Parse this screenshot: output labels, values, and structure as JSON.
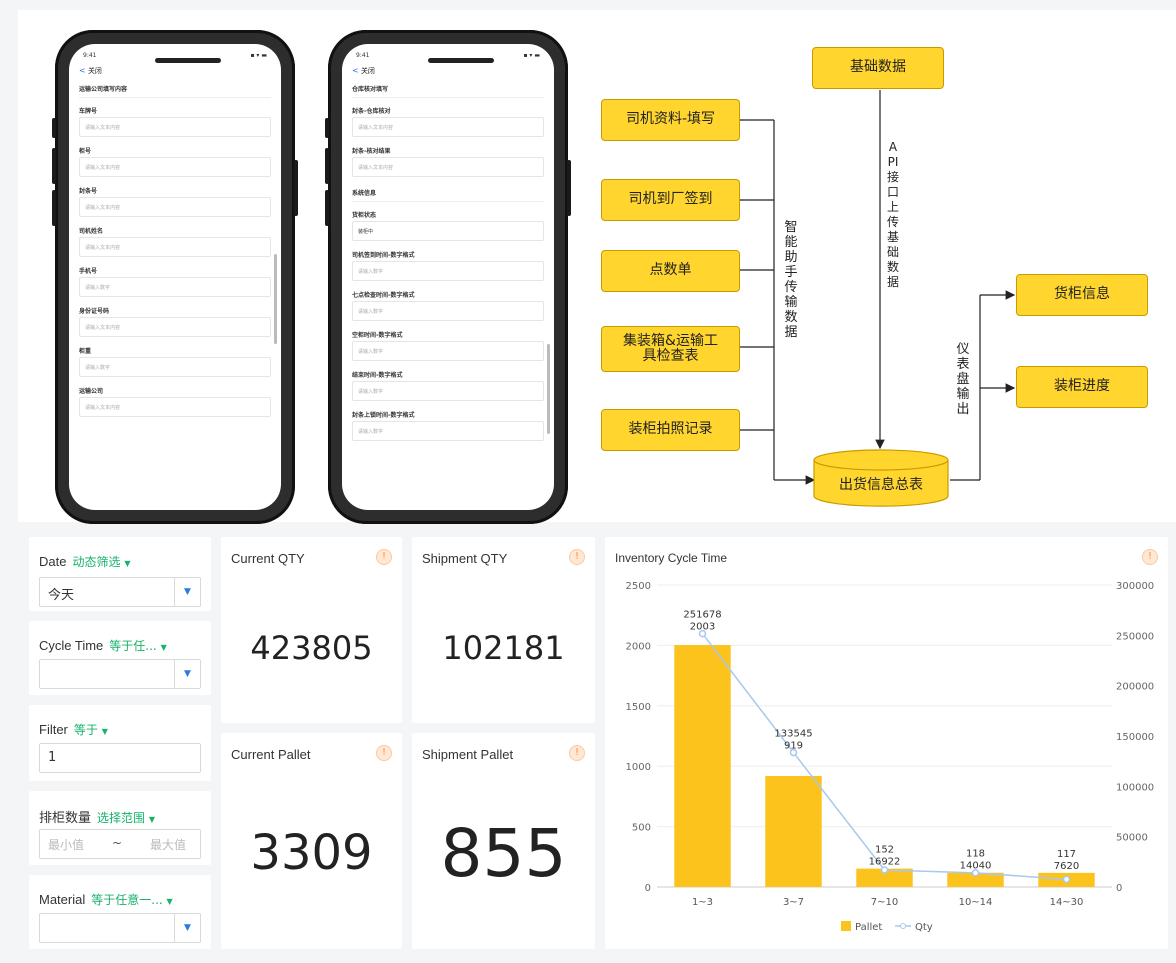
{
  "phone1": {
    "time": "9:41",
    "status_icons": "▪ ▾ ▬",
    "back_label": "关闭",
    "fields": [
      {
        "type": "section",
        "label": "运输公司填写内容"
      },
      {
        "type": "field",
        "label": "车牌号",
        "placeholder": "请输入文本内容"
      },
      {
        "type": "field",
        "label": "柜号",
        "placeholder": "请输入文本内容"
      },
      {
        "type": "field",
        "label": "封条号",
        "placeholder": "请输入文本内容"
      },
      {
        "type": "field",
        "label": "司机姓名",
        "placeholder": "请输入文本内容"
      },
      {
        "type": "field",
        "label": "手机号",
        "placeholder": "请输入数字"
      },
      {
        "type": "field",
        "label": "身份证号码",
        "placeholder": "请输入文本内容"
      },
      {
        "type": "field",
        "label": "柜重",
        "placeholder": "请输入数字"
      },
      {
        "type": "field",
        "label": "运输公司",
        "placeholder": "请输入文本内容"
      }
    ]
  },
  "phone2": {
    "time": "9:41",
    "status_icons": "▪ ▾ ▬",
    "back_label": "关闭",
    "fields": [
      {
        "type": "section",
        "label": "仓库核对填写"
      },
      {
        "type": "field",
        "label": "封条-仓库核对",
        "placeholder": "请输入文本内容"
      },
      {
        "type": "field",
        "label": "封条-核对结果",
        "placeholder": "请输入文本内容"
      },
      {
        "type": "section",
        "label": "系统信息"
      },
      {
        "type": "field",
        "label": "货柜状态",
        "value": "装柜中"
      },
      {
        "type": "field",
        "label": "司机签到时间-数字格式",
        "placeholder": "请输入数字"
      },
      {
        "type": "field",
        "label": "七点检查时间-数字格式",
        "placeholder": "请输入数字"
      },
      {
        "type": "field",
        "label": "空柜时间-数字格式",
        "placeholder": "请输入数字"
      },
      {
        "type": "field",
        "label": "结束时间-数字格式",
        "placeholder": "请输入数字"
      },
      {
        "type": "field",
        "label": "封条上锁时间-数字格式",
        "placeholder": "请输入数字"
      }
    ]
  },
  "flow": {
    "base_data": "基础数据",
    "inputs": [
      "司机资料-填写",
      "司机到厂签到",
      "点数单",
      "集装箱&运输工具检查表",
      "装柜拍照记录"
    ],
    "assistant_label": "智能助手传输数据",
    "api_label": "API接口上传基础数据",
    "dashboard_label": "仪表盘输出",
    "summary_table": "出货信息总表",
    "outputs": [
      "货柜信息",
      "装柜进度"
    ]
  },
  "filters": {
    "date": {
      "label": "Date",
      "op": "动态筛选",
      "value": "今天"
    },
    "cycle_time": {
      "label": "Cycle Time",
      "op": "等于任...",
      "value": ""
    },
    "filter": {
      "label": "Filter",
      "op": "等于",
      "value": "1"
    },
    "ranking": {
      "label": "排柜数量",
      "op": "选择范围",
      "min_placeholder": "最小值",
      "sep": "~",
      "max_placeholder": "最大值"
    },
    "material": {
      "label": "Material",
      "op": "等于任意一...",
      "value": ""
    }
  },
  "kpis": {
    "current_qty": {
      "title": "Current QTY",
      "value": "423805"
    },
    "shipment_qty": {
      "title": "Shipment QTY",
      "value": "102181"
    },
    "current_pallet": {
      "title": "Current Pallet",
      "value": "3309"
    },
    "shipment_pallet": {
      "title": "Shipment Pallet",
      "value": "855"
    }
  },
  "info_icon": "!",
  "dropdown_icon": "▼",
  "colors": {
    "accent": "#17b26a",
    "bar": "#fbc31c",
    "line": "#a9c8ee",
    "brand_blue": "#2a7ae2"
  },
  "chart_data": {
    "type": "bar",
    "title": "Inventory Cycle Time",
    "categories": [
      "1~3",
      "3~7",
      "7~10",
      "10~14",
      "14~30"
    ],
    "series": [
      {
        "name": "Pallet",
        "type": "bar",
        "axis": "left",
        "values": [
          2003,
          919,
          152,
          118,
          117
        ]
      },
      {
        "name": "Qty",
        "type": "line",
        "axis": "right",
        "values": [
          251678,
          133545,
          16922,
          14040,
          7620
        ]
      }
    ],
    "ylim": [
      0,
      2500
    ],
    "yticks": [
      0,
      500,
      1000,
      1500,
      2000,
      2500
    ],
    "y2lim": [
      0,
      300000
    ],
    "y2ticks": [
      0,
      50000,
      100000,
      150000,
      200000,
      250000,
      300000
    ],
    "legend": "bottom-center"
  }
}
